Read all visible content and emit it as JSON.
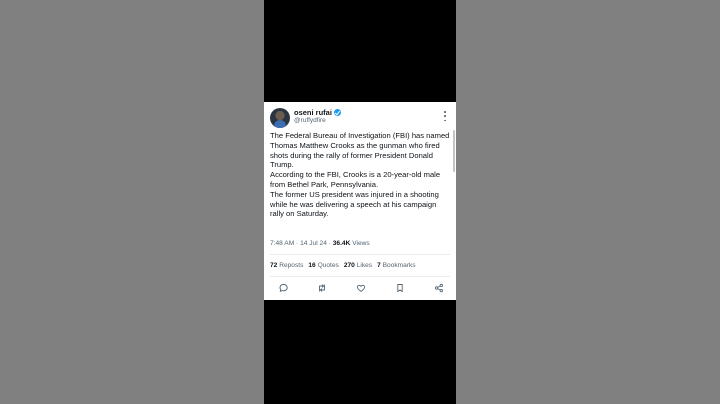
{
  "tweet": {
    "author_name": "oseni rufai",
    "handle": "@ruffydfire",
    "paragraphs": [
      "The Federal Bureau of Investigation (FBI) has named Thomas Matthew Crooks as the gunman who fired shots during the rally of former President Donald Trump.",
      "According to the FBI, Crooks is a 20-year-old male from Bethel Park, Pennsylvania.",
      "The former US president was injured in a shooting while he was delivering a speech at his campaign rally on Saturday."
    ],
    "time": "7:48 AM",
    "date": "14 Jul 24",
    "separator": "·",
    "views_count": "36.4K",
    "views_label": "Views",
    "stats": {
      "reposts_count": "72",
      "reposts_label": "Reposts",
      "quotes_count": "16",
      "quotes_label": "Quotes",
      "likes_count": "270",
      "likes_label": "Likes",
      "bookmarks_count": "7",
      "bookmarks_label": "Bookmarks"
    },
    "icons": [
      "reply-icon",
      "repost-icon",
      "like-icon",
      "bookmark-icon",
      "share-icon"
    ],
    "colors": {
      "verified": "#1d9bf0",
      "text": "#0f1419",
      "secondary": "#536471"
    }
  }
}
